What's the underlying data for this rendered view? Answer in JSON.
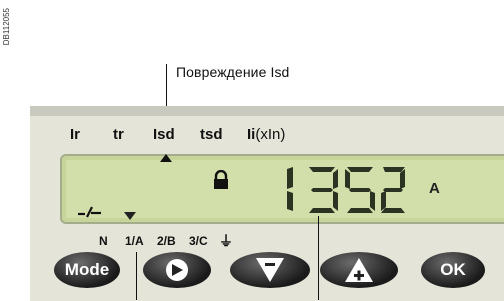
{
  "figure_code": "DB112055",
  "callout": "Повреждение Isd",
  "parameters": [
    {
      "bold": "Ir",
      "rest": ""
    },
    {
      "bold": "tr",
      "rest": ""
    },
    {
      "bold": "Isd",
      "rest": ""
    },
    {
      "bold": "tsd",
      "rest": ""
    },
    {
      "bold": "Ii",
      "rest": "(xIn)"
    }
  ],
  "display": {
    "value": "1352",
    "unit": "A",
    "state_icon": "lock-icon",
    "fault_icon": "trip-symbol-icon"
  },
  "phases": [
    "N",
    "1/A",
    "2/B",
    "3/C",
    "⏚"
  ],
  "buttons": {
    "mode": "Mode",
    "ok": "OK",
    "navigate": "arrow-right-icon",
    "down": "arrow-down-minus-icon",
    "up": "arrow-up-plus-icon"
  },
  "colors": {
    "lcd": "#d3dfaa",
    "panel": "#e4e5d8",
    "button": "#1a1a1a"
  }
}
